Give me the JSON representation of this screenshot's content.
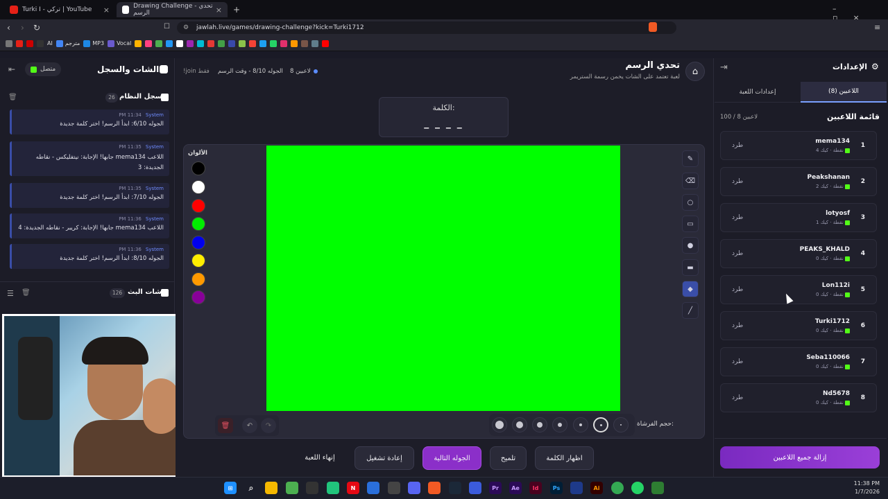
{
  "browser": {
    "tabs": [
      {
        "title": "Turki I - تركي | YouTube"
      },
      {
        "title": "Drawing Challenge - تحدي الرسم"
      }
    ],
    "url": "jawlah.live/games/drawing-challenge?kick=Turki1712",
    "bookmarks": [
      "AI",
      "مترجم",
      "MP3",
      "Vocal"
    ]
  },
  "left_panel": {
    "title": "الشات والسجل",
    "status": "متصل",
    "log": {
      "title": "سجل النظام",
      "count": "26"
    },
    "messages": [
      {
        "sender": "System",
        "time": "11:34 PM",
        "text": "الجوله 6/10: ابدأ الرسم! اختر كلمة جديدة"
      },
      {
        "sender": "System",
        "time": "11:35 PM",
        "text": "اللاعب mema134 جابها! الإجابة: نيتفليكس - نقاطه الجديدة: 3"
      },
      {
        "sender": "System",
        "time": "11:35 PM",
        "text": "الجوله 7/10: ابدأ الرسم! اختر كلمة جديدة"
      },
      {
        "sender": "System",
        "time": "11:36 PM",
        "text": "اللاعب mema134 جابها! الإجابة: كريبر - نقاطه الجديدة: 4"
      },
      {
        "sender": "System",
        "time": "11:36 PM",
        "text": "الجوله 8/10: ابدأ الرسم! اختر كلمة جديدة"
      }
    ],
    "chat": {
      "title": "شات البث",
      "count": "126"
    }
  },
  "game": {
    "title": "تحدي الرسم",
    "subtitle": "لعبة تعتمد على الشات يخمن رسمة الستريمر",
    "players_count": "8 لاعبين",
    "round": "الجوله 8/10 - وقت الرسم",
    "join_hint": "!join فقط",
    "word_label": "الكلمة:",
    "word_mask": "_ _ _ _",
    "colors_label": "الألوان",
    "brush_label": "حجم الفرشاة:",
    "canvas_color": "#00ff00",
    "palette": [
      "#000000",
      "#ffffff",
      "#ff0000",
      "#00ee00",
      "#0000ee",
      "#ffee00",
      "#ff9900",
      "#880099"
    ],
    "buttons": {
      "end": "إنهاء اللعبة",
      "restart": "إعادة تشغيل",
      "next": "الجوله التالية",
      "hint": "تلميح",
      "reveal": "اظهار الكلمة"
    }
  },
  "right_panel": {
    "title": "الإعدادات",
    "tab_players": "اللاعبين (8)",
    "tab_settings": "إعدادات اللعبة",
    "list_title": "قائمة اللاعبين",
    "list_count": "100 / 8 لاعبين",
    "kick_label": "طرد",
    "meta_label": "كيك",
    "players": [
      {
        "rank": "1",
        "name": "mema134",
        "points": "4 نقطة"
      },
      {
        "rank": "2",
        "name": "Peakshanan",
        "points": "2 نقطة"
      },
      {
        "rank": "3",
        "name": "lotyosf",
        "points": "1 نقطة"
      },
      {
        "rank": "4",
        "name": "PEAKS_KHALD",
        "points": "0 نقطة"
      },
      {
        "rank": "5",
        "name": "Lon112i",
        "points": "0 نقطة"
      },
      {
        "rank": "6",
        "name": "Turki1712",
        "points": "0 نقطة"
      },
      {
        "rank": "7",
        "name": "Seba110066",
        "points": "0 نقطة"
      },
      {
        "rank": "8",
        "name": "Nd5678",
        "points": "0 نقطة"
      }
    ],
    "remove_all": "إزالة جميع اللاعبين"
  },
  "taskbar": {
    "time": "11:38 PM",
    "date": "1/7/2026"
  }
}
